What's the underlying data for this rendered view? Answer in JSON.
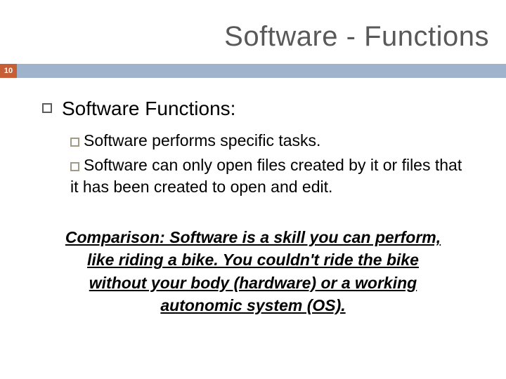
{
  "title": "Software - Functions",
  "page_number": "10",
  "main": {
    "heading": "Software Functions:",
    "items": [
      "Software performs specific tasks.",
      "Software can only open files created by it or files that it has been created to open and edit."
    ]
  },
  "comparison": "Comparison: Software is a skill you can perform, like riding a bike. You couldn't ride the bike without your body (hardware) or a working autonomic system (OS)."
}
